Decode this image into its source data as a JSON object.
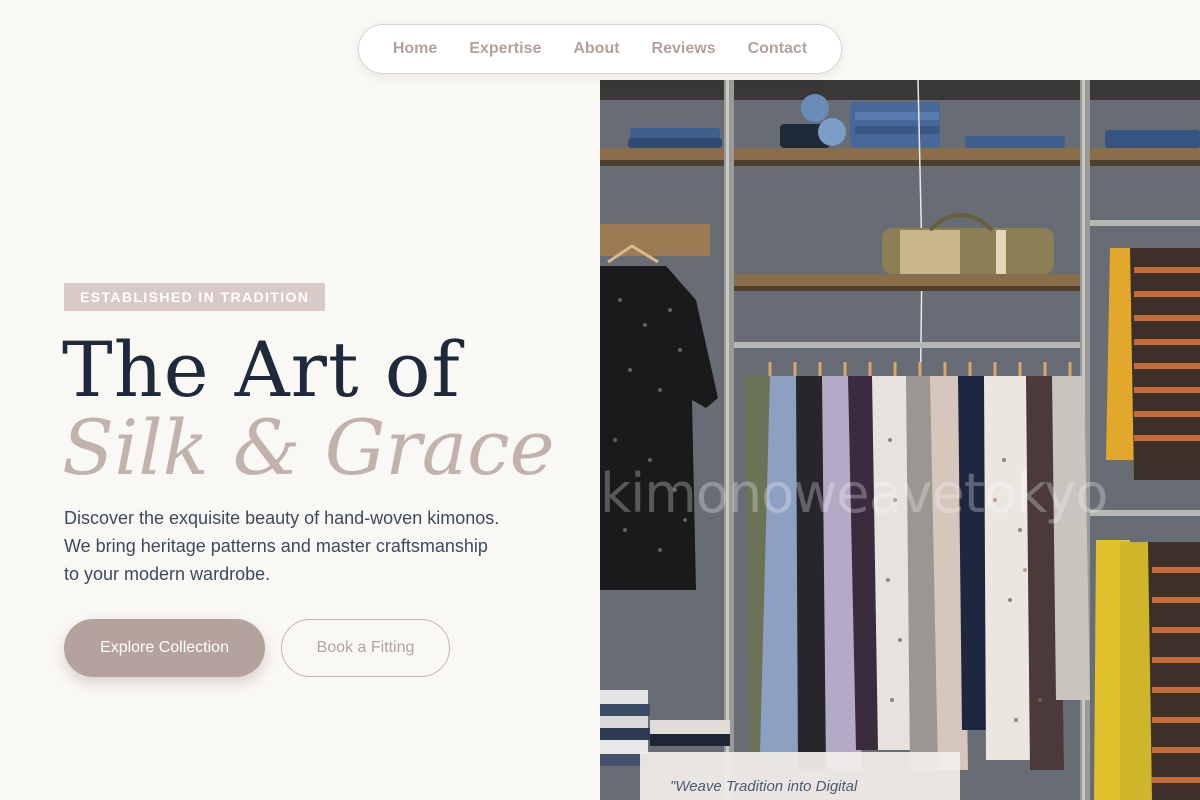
{
  "nav": {
    "items": [
      {
        "label": "Home"
      },
      {
        "label": "Expertise"
      },
      {
        "label": "About"
      },
      {
        "label": "Reviews"
      },
      {
        "label": "Contact"
      }
    ]
  },
  "hero": {
    "badge": "ESTABLISHED IN TRADITION",
    "title_line1": "The Art of",
    "title_line2": "Silk & Grace",
    "description": "Discover the exquisite beauty of hand-woven kimonos. We bring heritage patterns and master craftsmanship to your modern wardrobe.",
    "primary_button": "Explore Collection",
    "secondary_button": "Book a Fitting"
  },
  "image": {
    "watermark": "kimonoweavetokyo",
    "quote": "\"Weave Tradition into Digital"
  },
  "colors": {
    "background": "#faf8f5",
    "accent": "#b4a29c",
    "title_dark": "#1e2a3c",
    "badge_bg": "#d8cac6"
  }
}
